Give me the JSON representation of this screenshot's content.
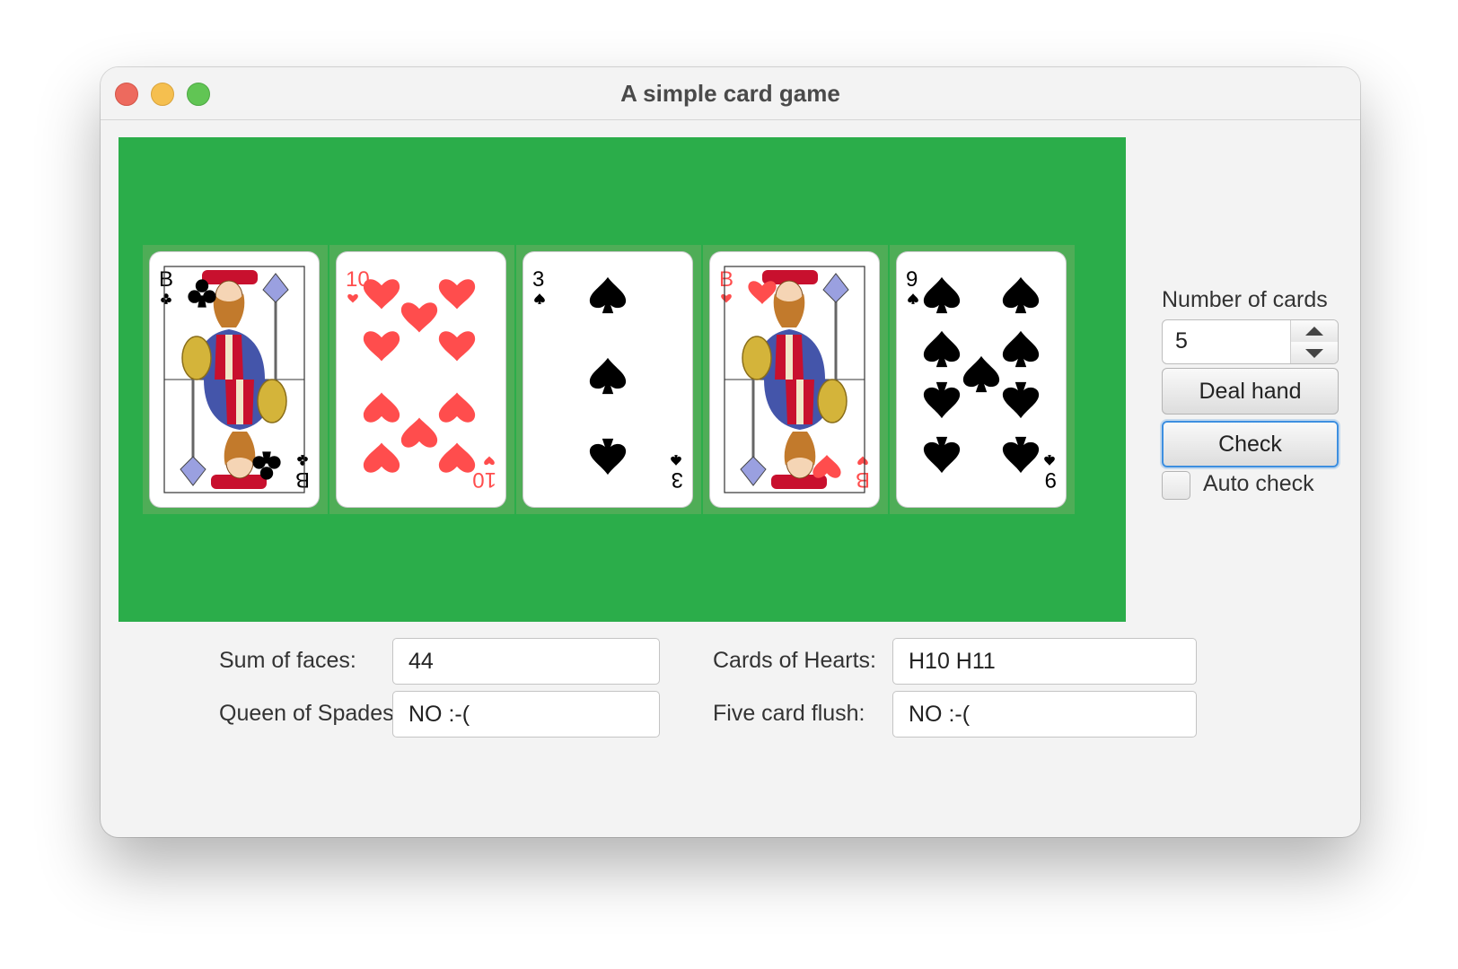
{
  "window": {
    "title": "A simple card game"
  },
  "hand": {
    "cards": [
      {
        "rank": "B",
        "suit": "clubs",
        "color": "#000000",
        "type": "face"
      },
      {
        "rank": "10",
        "suit": "hearts",
        "color": "#ff4d4d",
        "type": "number"
      },
      {
        "rank": "3",
        "suit": "spades",
        "color": "#000000",
        "type": "number"
      },
      {
        "rank": "B",
        "suit": "hearts",
        "color": "#ff4d4d",
        "type": "face"
      },
      {
        "rank": "9",
        "suit": "spades",
        "color": "#000000",
        "type": "number"
      }
    ]
  },
  "controls": {
    "number_of_cards_label": "Number of cards",
    "number_of_cards_value": "5",
    "deal_button": "Deal hand",
    "check_button": "Check",
    "auto_check_label": "Auto check",
    "auto_check_checked": false
  },
  "results": {
    "sum_label": "Sum of faces:",
    "sum_value": "44",
    "hearts_label": "Cards of Hearts:",
    "hearts_value": "H10 H11",
    "queen_label": "Queen of Spades:",
    "queen_value": "NO :-(",
    "flush_label": "Five card flush:",
    "flush_value": "NO :-("
  },
  "colors": {
    "table": "#2bad4a",
    "hearts": "#ff4d4d",
    "spades": "#000000",
    "focus": "#3d8fe0"
  }
}
